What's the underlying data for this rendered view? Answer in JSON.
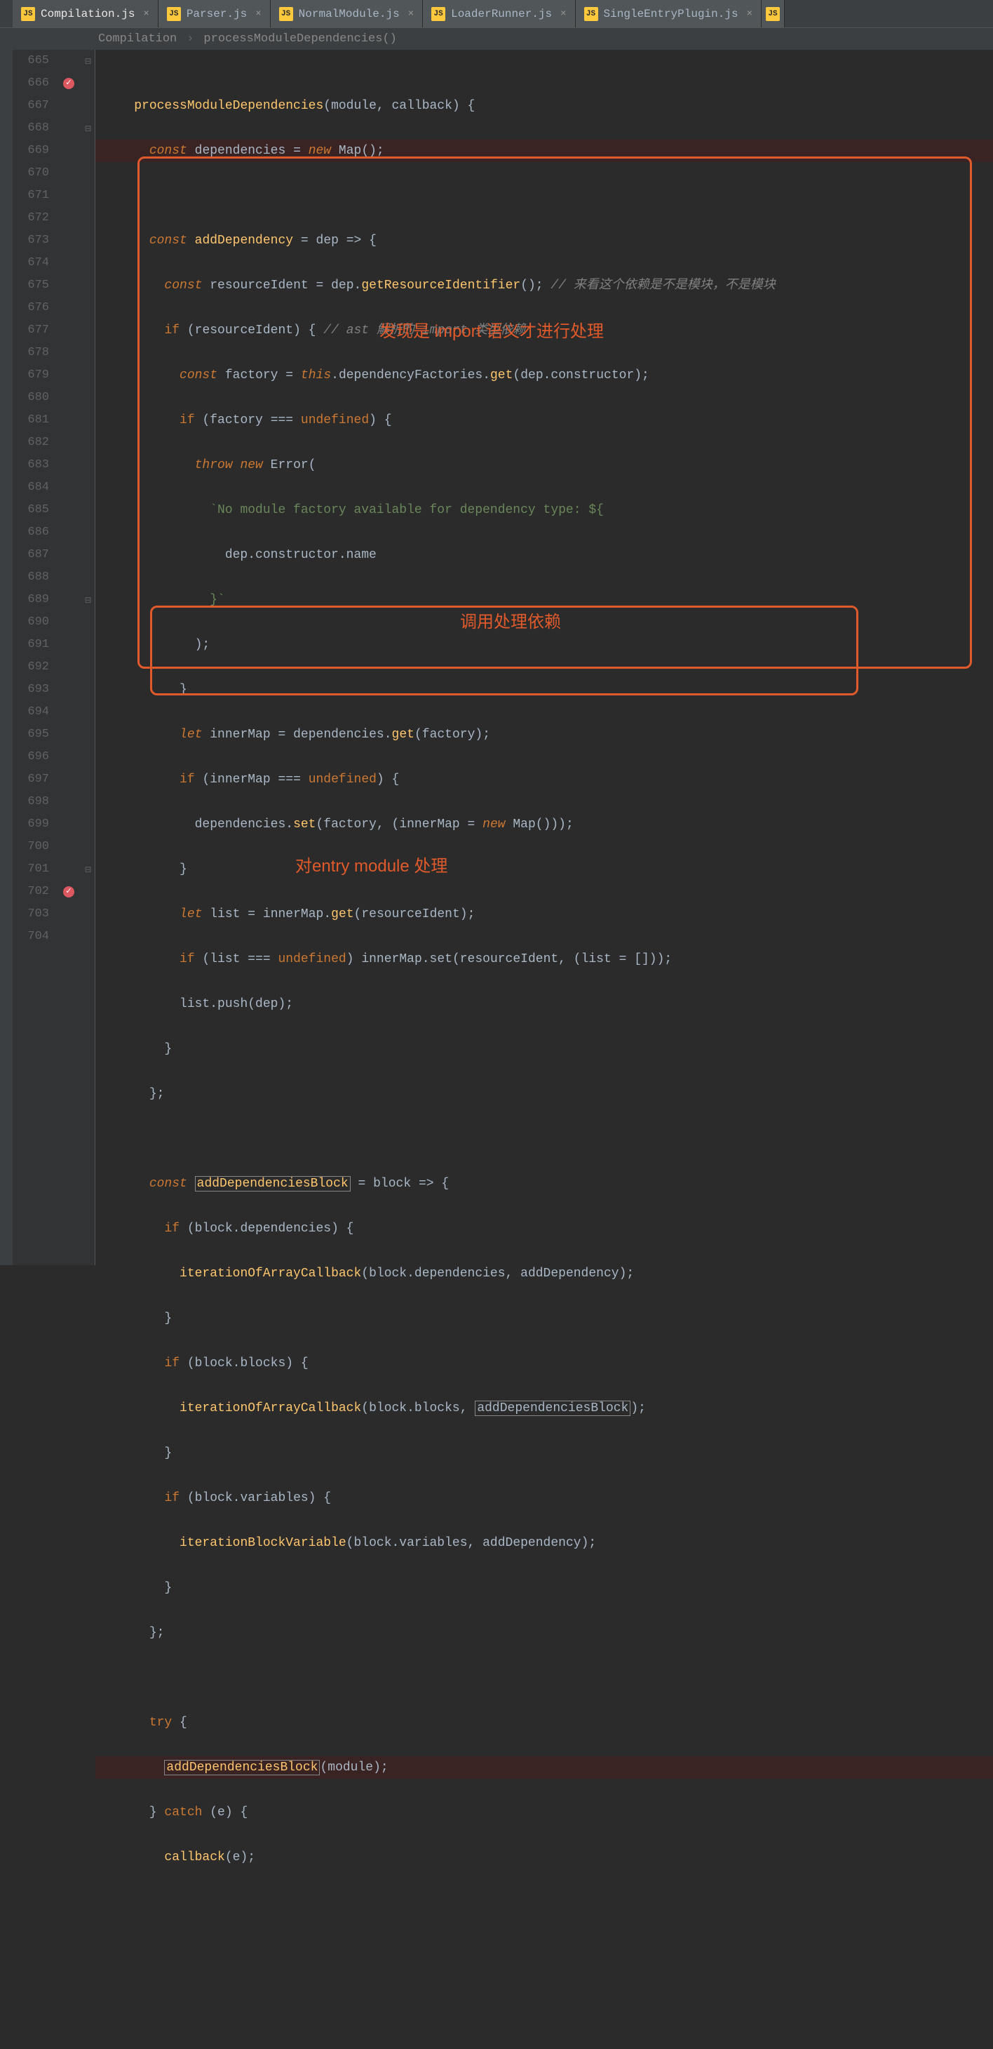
{
  "tabs": [
    {
      "label": "Compilation.js",
      "active": true
    },
    {
      "label": "Parser.js",
      "active": false
    },
    {
      "label": "NormalModule.js",
      "active": false
    },
    {
      "label": "LoaderRunner.js",
      "active": false
    },
    {
      "label": "SingleEntryPlugin.js",
      "active": false
    }
  ],
  "breadcrumb": {
    "item1": "Compilation",
    "sep": "›",
    "item2": "processModuleDependencies()"
  },
  "line_start": 665,
  "line_end": 704,
  "breakpoint_lines": [
    666,
    702
  ],
  "annotations": {
    "a1": "发现是 import 语义才进行处理",
    "a2": "调用处理依赖",
    "a3": "对entry module 处理"
  },
  "code": {
    "l665": {
      "fn": "processModuleDependencies",
      "p1": "module",
      "p2": "callback"
    },
    "l666": {
      "kw": "const",
      "var": "dependencies",
      "op": "=",
      "new": "new",
      "cls": "Map"
    },
    "l668": {
      "kw": "const",
      "var": "addDependency",
      "op": "=",
      "p": "dep",
      "arrow": "=>"
    },
    "l669": {
      "kw": "const",
      "var": "resourceIdent",
      "op": "=",
      "obj": "dep",
      "m": "getResourceIdentifier",
      "cmt": "// 来看这个依赖是不是模块，不是模块"
    },
    "l670": {
      "if": "if",
      "cond": "resourceIdent",
      "cmt": "// ast 解析的 import 类型依赖"
    },
    "l671": {
      "kw": "const",
      "var": "factory",
      "op": "=",
      "this": "this",
      "prop": "dependencyFactories",
      "m": "get",
      "arg": "dep.constructor"
    },
    "l672": {
      "if": "if",
      "l": "factory",
      "op": "===",
      "r": "undefined"
    },
    "l673": {
      "throw": "throw",
      "new": "new",
      "cls": "Error"
    },
    "l674": {
      "txt": "`No module factory available for dependency type: ${"
    },
    "l675": {
      "txt": "dep.constructor.name"
    },
    "l676": {
      "txt": "}`"
    },
    "l677": {
      "txt": ");"
    },
    "l678": {
      "txt": "}"
    },
    "l679": {
      "let": "let",
      "var": "innerMap",
      "op": "=",
      "obj": "dependencies",
      "m": "get",
      "arg": "factory"
    },
    "l680": {
      "if": "if",
      "l": "innerMap",
      "op": "===",
      "r": "undefined"
    },
    "l681": {
      "obj": "dependencies",
      "m": "set",
      "a1": "factory",
      "a2p": "(innerMap = ",
      "new": "new",
      "cls": "Map",
      "a2s": "())"
    },
    "l682": {
      "txt": "}"
    },
    "l683": {
      "let": "let",
      "var": "list",
      "op": "=",
      "obj": "innerMap",
      "m": "get",
      "arg": "resourceIdent"
    },
    "l684": {
      "if": "if",
      "l": "list",
      "op": "===",
      "r": "undefined",
      "then": "innerMap.set(resourceIdent, (list = []));"
    },
    "l685": {
      "txt": "list.push(dep);"
    },
    "l686": {
      "txt": "}"
    },
    "l687": {
      "txt": "};"
    },
    "l689": {
      "kw": "const",
      "var": "addDependenciesBlock",
      "op": "=",
      "p": "block",
      "arrow": "=>"
    },
    "l690": {
      "if": "if",
      "cond": "block.dependencies"
    },
    "l691": {
      "fn": "iterationOfArrayCallback",
      "a1": "block.dependencies",
      "a2": "addDependency"
    },
    "l692": {
      "txt": "}"
    },
    "l693": {
      "if": "if",
      "cond": "block.blocks"
    },
    "l694": {
      "fn": "iterationOfArrayCallback",
      "a1": "block.blocks",
      "a2": "addDependenciesBlock"
    },
    "l695": {
      "txt": "}"
    },
    "l696": {
      "if": "if",
      "cond": "block.variables"
    },
    "l697": {
      "fn": "iterationBlockVariable",
      "a1": "block.variables",
      "a2": "addDependency"
    },
    "l698": {
      "txt": "}"
    },
    "l699": {
      "txt": "};"
    },
    "l701": {
      "try": "try"
    },
    "l702": {
      "fn": "addDependenciesBlock",
      "arg": "module"
    },
    "l703": {
      "catch": "catch",
      "e": "e"
    },
    "l704": {
      "fn": "callback",
      "arg": "e"
    }
  }
}
